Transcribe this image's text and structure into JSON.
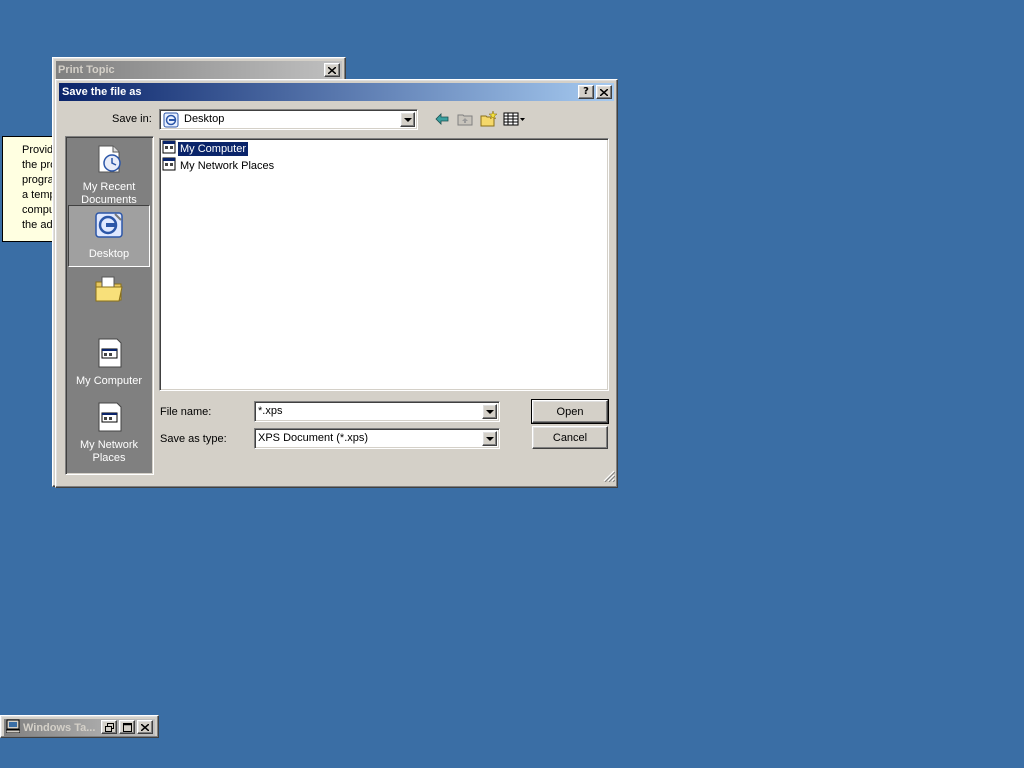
{
  "background_window": {
    "title": "Print Topic"
  },
  "tooltip": {
    "lines": [
      "Provid",
      "the pro",
      "progra",
      "a temp",
      "compu",
      "the ad"
    ]
  },
  "dialog": {
    "title": "Save the file as",
    "help_button": "?",
    "close_button": "✕",
    "save_in_label": "Save in:",
    "save_in_value": "Desktop",
    "places": [
      {
        "label": "My Recent Documents",
        "icon": "recent-documents-icon"
      },
      {
        "label": "Desktop",
        "icon": "desktop-icon"
      },
      {
        "label": "",
        "icon": "my-documents-folder-icon"
      },
      {
        "label": "My Computer",
        "icon": "my-computer-icon"
      },
      {
        "label": "My Network Places",
        "icon": "my-network-places-icon"
      }
    ],
    "files": [
      {
        "name": "My Computer",
        "icon": "my-computer-icon",
        "selected": true
      },
      {
        "name": "My Network Places",
        "icon": "my-network-places-icon",
        "selected": false
      }
    ],
    "file_name_label": "File name:",
    "file_name_value": "*.xps",
    "save_as_type_label": "Save as type:",
    "save_as_type_value": "XPS Document (*.xps)",
    "open_button": "Open",
    "cancel_button": "Cancel"
  },
  "taskbar_window": {
    "title": "Windows Ta..."
  },
  "colors": {
    "desktop": "#3a6ea5",
    "title_active_start": "#0a246a",
    "title_active_end": "#a6caf0",
    "title_inactive_start": "#808080",
    "title_inactive_end": "#c0c0c0",
    "places_bar": "#808080",
    "selection": "#0a246a"
  }
}
